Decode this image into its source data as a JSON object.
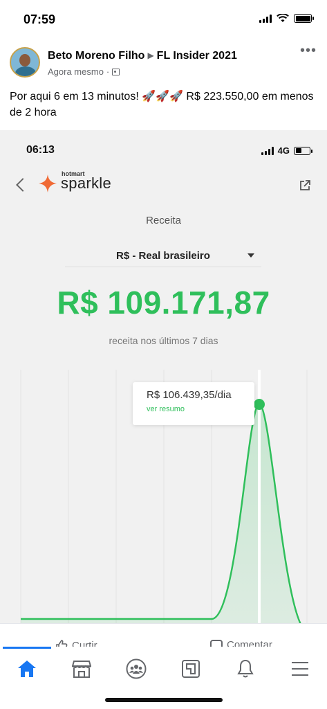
{
  "status_bar": {
    "time": "07:59"
  },
  "post": {
    "author": "Beto Moreno Filho",
    "group": "FL Insider 2021",
    "timestamp": "Agora mesmo",
    "text": "Por aqui 6 em 13 minutos! 🚀🚀🚀 R$ 223.550,00 em menos de 2 hora"
  },
  "embedded": {
    "status_time": "06:13",
    "network": "4G",
    "logo_small": "hotmart",
    "logo_main": "sparkle",
    "section_title": "Receita",
    "currency": "R$ - Real brasileiro",
    "amount": "R$ 109.171,87",
    "amount_caption": "receita nos últimos 7 dias",
    "tooltip_value": "R$ 106.439,35/dia",
    "tooltip_link": "ver resumo",
    "accent_color": "#2fbf5b"
  },
  "chart_data": {
    "type": "area",
    "x": [
      1,
      2,
      3,
      4,
      5,
      6,
      7
    ],
    "values": [
      0,
      0,
      0,
      0,
      0,
      106439.35,
      0
    ],
    "highlighted_value": "R$ 106.439,35/dia",
    "grid": true
  },
  "reactions": {
    "like_label": "Curtir",
    "comment_label": "Comentar"
  },
  "nav": {
    "items": [
      "home-icon",
      "marketplace-icon",
      "groups-icon",
      "pages-icon",
      "notifications-icon",
      "menu-icon"
    ]
  }
}
